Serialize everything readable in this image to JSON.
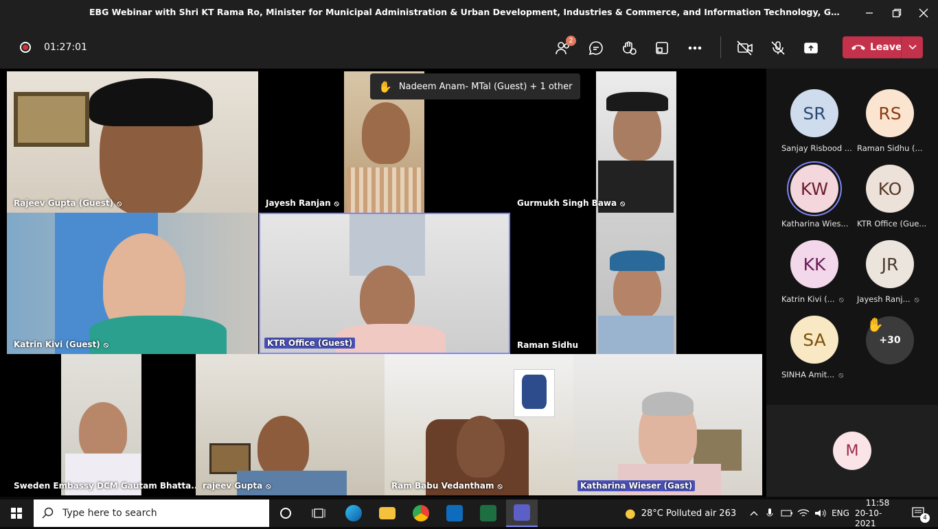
{
  "window": {
    "title": "EBG Webinar with Shri KT Rama Ro, Minister for Municipal Administration & Urban Development, Industries & Commerce, and Information Technology, Government of Telen..."
  },
  "toolbar": {
    "timer": "01:27:01",
    "participants_badge": "2",
    "leave_label": "Leave"
  },
  "raised_hand_banner": "Nadeem Anam- MTal (Guest) + 1 other",
  "tiles": [
    {
      "name": "Rajeev Gupta (Guest)"
    },
    {
      "name": "Jayesh Ranjan"
    },
    {
      "name": "Gurmukh Singh Bawa"
    },
    {
      "name": "Katrin Kivi (Guest)"
    },
    {
      "name": "KTR Office (Guest)"
    },
    {
      "name": "Raman Sidhu"
    },
    {
      "name": "Sweden Embassy DCM Gautam Bhatta..."
    },
    {
      "name": "rajeev Gupta"
    },
    {
      "name": "Ram Babu Vedantham"
    },
    {
      "name": "Katharina Wieser (Gast)"
    }
  ],
  "roster": [
    {
      "initials": "SR",
      "name": "Sanjay Risbood ...",
      "muted": false
    },
    {
      "initials": "RS",
      "name": "Raman Sidhu (...",
      "muted": false
    },
    {
      "initials": "KW",
      "name": "Katharina Wies...",
      "muted": false
    },
    {
      "initials": "KO",
      "name": "KTR Office (Gue...",
      "muted": false
    },
    {
      "initials": "KK",
      "name": "Katrin Kivi (...",
      "muted": true
    },
    {
      "initials": "JR",
      "name": "Jayesh Ranj...",
      "muted": true
    },
    {
      "initials": "SA",
      "name": "SINHA Amit...",
      "muted": true
    }
  ],
  "overflow_count": "+30",
  "self_initial": "M",
  "taskbar": {
    "search_placeholder": "Type here to search",
    "weather": "28°C  Polluted air 263",
    "language": "ENG",
    "time": "11:58",
    "date": "20-10-2021",
    "notifications": "4"
  },
  "colors": {
    "leave": "#c4314b",
    "raised_hand": "#f8c840",
    "speaking_ring": "#7f85f5",
    "name_highlight": "#4b53bc"
  }
}
